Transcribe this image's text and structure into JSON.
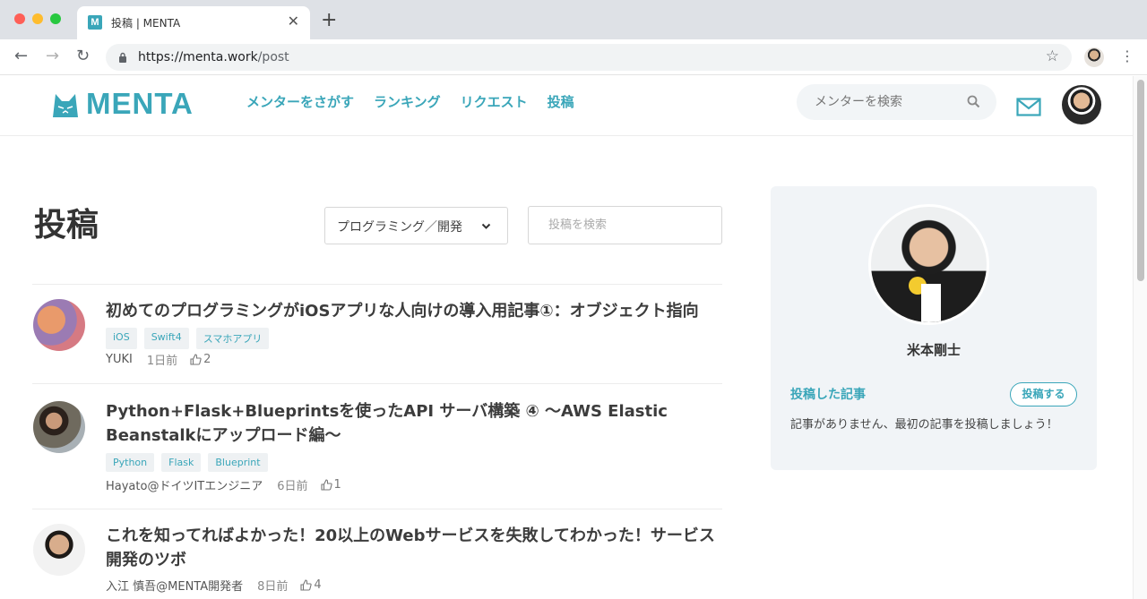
{
  "browser": {
    "tab_title": "投稿 | MENTA",
    "favicon_letter": "M",
    "url_host": "https://menta.work",
    "url_path": "/post"
  },
  "header": {
    "logo_text": "MENTA",
    "nav": [
      "メンターをさがす",
      "ランキング",
      "リクエスト",
      "投稿"
    ],
    "search_placeholder": "メンターを検索"
  },
  "main": {
    "title": "投稿",
    "category_selected": "プログラミング／開発",
    "search_placeholder": "投稿を検索",
    "posts": [
      {
        "title": "初めてのプログラミングがiOSアプリな人向けの導入用記事①：オブジェクト指向",
        "tags": [
          "iOS",
          "Swift4",
          "スマホアプリ"
        ],
        "author": "YUKI",
        "time": "1日前",
        "likes": "2"
      },
      {
        "title": "Python+Flask+Blueprintsを使ったAPI サーバ構築 ④ 〜AWS Elastic Beanstalkにアップロード編〜",
        "tags": [
          "Python",
          "Flask",
          "Blueprint"
        ],
        "author": "Hayato@ドイツITエンジニア",
        "time": "6日前",
        "likes": "1"
      },
      {
        "title": "これを知ってればよかった！20以上のWebサービスを失敗してわかった！サービス開発のツボ",
        "tags": [],
        "author": "入江 慎吾@MENTA開発者",
        "time": "8日前",
        "likes": "4"
      }
    ]
  },
  "sidebar": {
    "name": "米本剛士",
    "section_title": "投稿した記事",
    "post_button": "投稿する",
    "empty_message": "記事がありません、最初の記事を投稿しましょう！"
  },
  "colors": {
    "accent": "#3aa6b9",
    "sidebar_bg": "#f1f4f7",
    "tag_bg": "#eef1f3"
  }
}
